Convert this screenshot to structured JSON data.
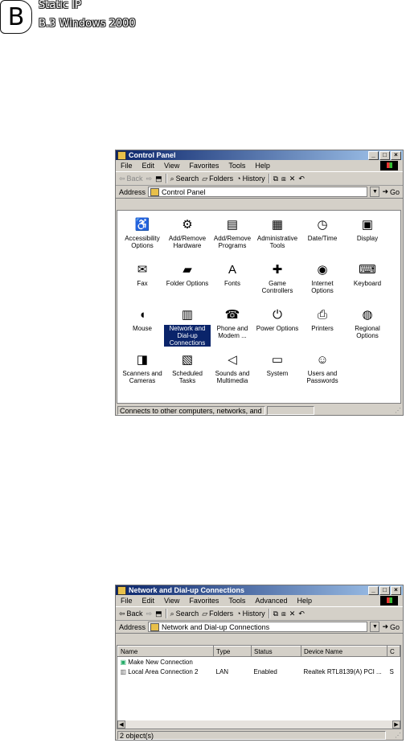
{
  "header": {
    "badge": "B",
    "title": "Static IP",
    "subtitle": "B.3  Windows 2000"
  },
  "control_panel": {
    "title": "Control Panel",
    "menu": [
      "File",
      "Edit",
      "View",
      "Favorites",
      "Tools",
      "Help"
    ],
    "toolbar": {
      "back": "Back",
      "search": "Search",
      "folders": "Folders",
      "history": "History"
    },
    "address_label": "Address",
    "address_value": "Control Panel",
    "go": "Go",
    "items": [
      {
        "label": "Accessibility Options",
        "icon": "accessibility-icon",
        "glyph": "♿"
      },
      {
        "label": "Add/Remove Hardware",
        "icon": "hardware-icon",
        "glyph": "⚙"
      },
      {
        "label": "Add/Remove Programs",
        "icon": "programs-icon",
        "glyph": "▤"
      },
      {
        "label": "Administrative Tools",
        "icon": "admin-tools-icon",
        "glyph": "▦"
      },
      {
        "label": "Date/Time",
        "icon": "clock-icon",
        "glyph": "◷"
      },
      {
        "label": "Display",
        "icon": "display-icon",
        "glyph": "▣"
      },
      {
        "label": "Fax",
        "icon": "fax-icon",
        "glyph": "✉"
      },
      {
        "label": "Folder Options",
        "icon": "folder-options-icon",
        "glyph": "▰"
      },
      {
        "label": "Fonts",
        "icon": "fonts-icon",
        "glyph": "A"
      },
      {
        "label": "Game Controllers",
        "icon": "joystick-icon",
        "glyph": "✚"
      },
      {
        "label": "Internet Options",
        "icon": "internet-icon",
        "glyph": "◉"
      },
      {
        "label": "Keyboard",
        "icon": "keyboard-icon",
        "glyph": "⌨"
      },
      {
        "label": "Mouse",
        "icon": "mouse-icon",
        "glyph": "◖"
      },
      {
        "label": "Network and Dial-up Connections",
        "icon": "network-icon",
        "glyph": "▥",
        "selected": true
      },
      {
        "label": "Phone and Modem ...",
        "icon": "phone-icon",
        "glyph": "☎"
      },
      {
        "label": "Power Options",
        "icon": "power-icon",
        "glyph": "⏻"
      },
      {
        "label": "Printers",
        "icon": "printer-icon",
        "glyph": "⎙"
      },
      {
        "label": "Regional Options",
        "icon": "globe-icon",
        "glyph": "◍"
      },
      {
        "label": "Scanners and Cameras",
        "icon": "scanner-icon",
        "glyph": "◨"
      },
      {
        "label": "Scheduled Tasks",
        "icon": "tasks-icon",
        "glyph": "▧"
      },
      {
        "label": "Sounds and Multimedia",
        "icon": "speaker-icon",
        "glyph": "◁"
      },
      {
        "label": "System",
        "icon": "computer-icon",
        "glyph": "▭"
      },
      {
        "label": "Users and Passwords",
        "icon": "users-icon",
        "glyph": "☺"
      }
    ],
    "status": "Connects to other computers, networks, and the"
  },
  "network_window": {
    "title": "Network and Dial-up Connections",
    "menu": [
      "File",
      "Edit",
      "View",
      "Favorites",
      "Tools",
      "Advanced",
      "Help"
    ],
    "toolbar": {
      "back": "Back",
      "search": "Search",
      "folders": "Folders",
      "history": "History"
    },
    "address_label": "Address",
    "address_value": "Network and Dial-up Connections",
    "go": "Go",
    "columns": [
      "Name",
      "Type",
      "Status",
      "Device Name",
      "C"
    ],
    "rows": [
      {
        "name": "Make New Connection",
        "type": "",
        "status": "",
        "device": "",
        "c": ""
      },
      {
        "name": "Local Area Connection 2",
        "type": "LAN",
        "status": "Enabled",
        "device": "Realtek RTL8139(A) PCI ...",
        "c": "S"
      }
    ],
    "status": "2 object(s)"
  }
}
